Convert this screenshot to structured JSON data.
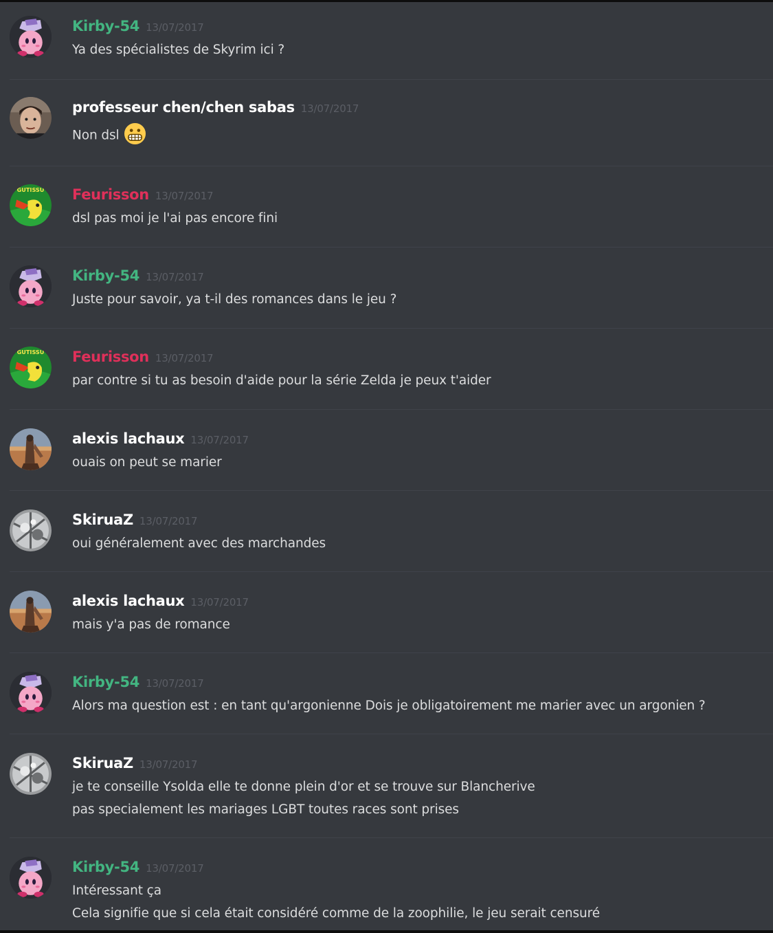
{
  "colors": {
    "background": "#36393e",
    "text": "#dcddde",
    "timestamp": "#5b5e65",
    "kirby": "#43b581",
    "feurisson": "#e0305a",
    "default_user": "#ffffff"
  },
  "messages": [
    {
      "author": "Kirby-54",
      "timestamp": "13/07/2017",
      "avatar": "kirby-avatar",
      "lines": [
        "Ya des spécialistes de Skyrim ici ?"
      ]
    },
    {
      "author": "professeur chen/chen sabas",
      "timestamp": "13/07/2017",
      "avatar": "chen-avatar",
      "lines": [
        "Non dsl"
      ],
      "emoji": "grimacing-face-emoji"
    },
    {
      "author": "Feurisson",
      "timestamp": "13/07/2017",
      "avatar": "feurisson-avatar",
      "lines": [
        "dsl pas moi je l'ai pas encore fini"
      ]
    },
    {
      "author": "Kirby-54",
      "timestamp": "13/07/2017",
      "avatar": "kirby-avatar",
      "lines": [
        "Juste pour savoir, ya t-il des romances dans le jeu ?"
      ]
    },
    {
      "author": "Feurisson",
      "timestamp": "13/07/2017",
      "avatar": "feurisson-avatar",
      "lines": [
        "par contre si tu as besoin d'aide pour la série Zelda je peux t'aider"
      ]
    },
    {
      "author": "alexis lachaux",
      "timestamp": "13/07/2017",
      "avatar": "alexis-avatar",
      "lines": [
        "ouais on peut se marier"
      ]
    },
    {
      "author": "SkiruaZ",
      "timestamp": "13/07/2017",
      "avatar": "skiruaz-avatar",
      "lines": [
        "oui généralement avec des marchandes"
      ]
    },
    {
      "author": "alexis lachaux",
      "timestamp": "13/07/2017",
      "avatar": "alexis-avatar",
      "lines": [
        "mais y'a pas de romance"
      ]
    },
    {
      "author": "Kirby-54",
      "timestamp": "13/07/2017",
      "avatar": "kirby-avatar",
      "lines": [
        "Alors ma question est : en tant qu'argonienne Dois je obligatoirement me marier avec un argonien ?"
      ]
    },
    {
      "author": "SkiruaZ",
      "timestamp": "13/07/2017",
      "avatar": "skiruaz-avatar",
      "lines": [
        "je te conseille Ysolda elle te donne plein d'or et se trouve sur Blancherive",
        "pas specialement les mariages LGBT toutes races sont prises"
      ]
    },
    {
      "author": "Kirby-54",
      "timestamp": "13/07/2017",
      "avatar": "kirby-avatar",
      "lines": [
        "Intéressant ça",
        "Cela signifie que si cela était considéré comme de la zoophilie, le jeu serait censuré"
      ]
    }
  ]
}
